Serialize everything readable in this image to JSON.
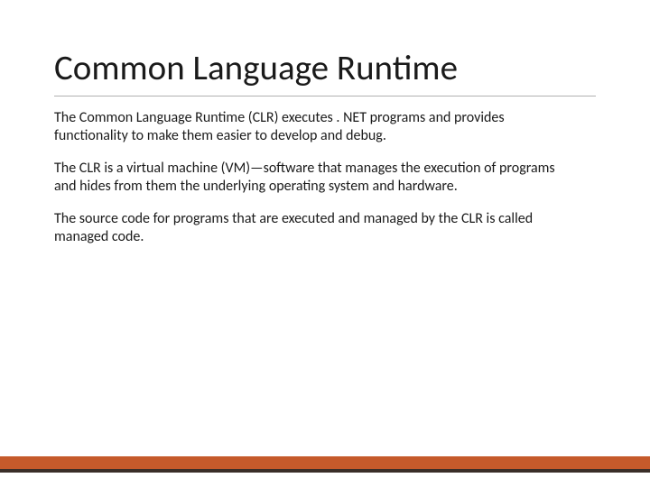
{
  "slide": {
    "title": "Common Language Runtime",
    "paragraphs": [
      "The Common Language Runtime (CLR) executes . NET programs and provides functionality to make them easier to develop and debug.",
      "The CLR is a virtual machine (VM)—software that manages the execution of programs and hides from them the underlying operating system and hardware.",
      "The source code for programs that are executed and managed by the CLR is called managed code."
    ]
  }
}
